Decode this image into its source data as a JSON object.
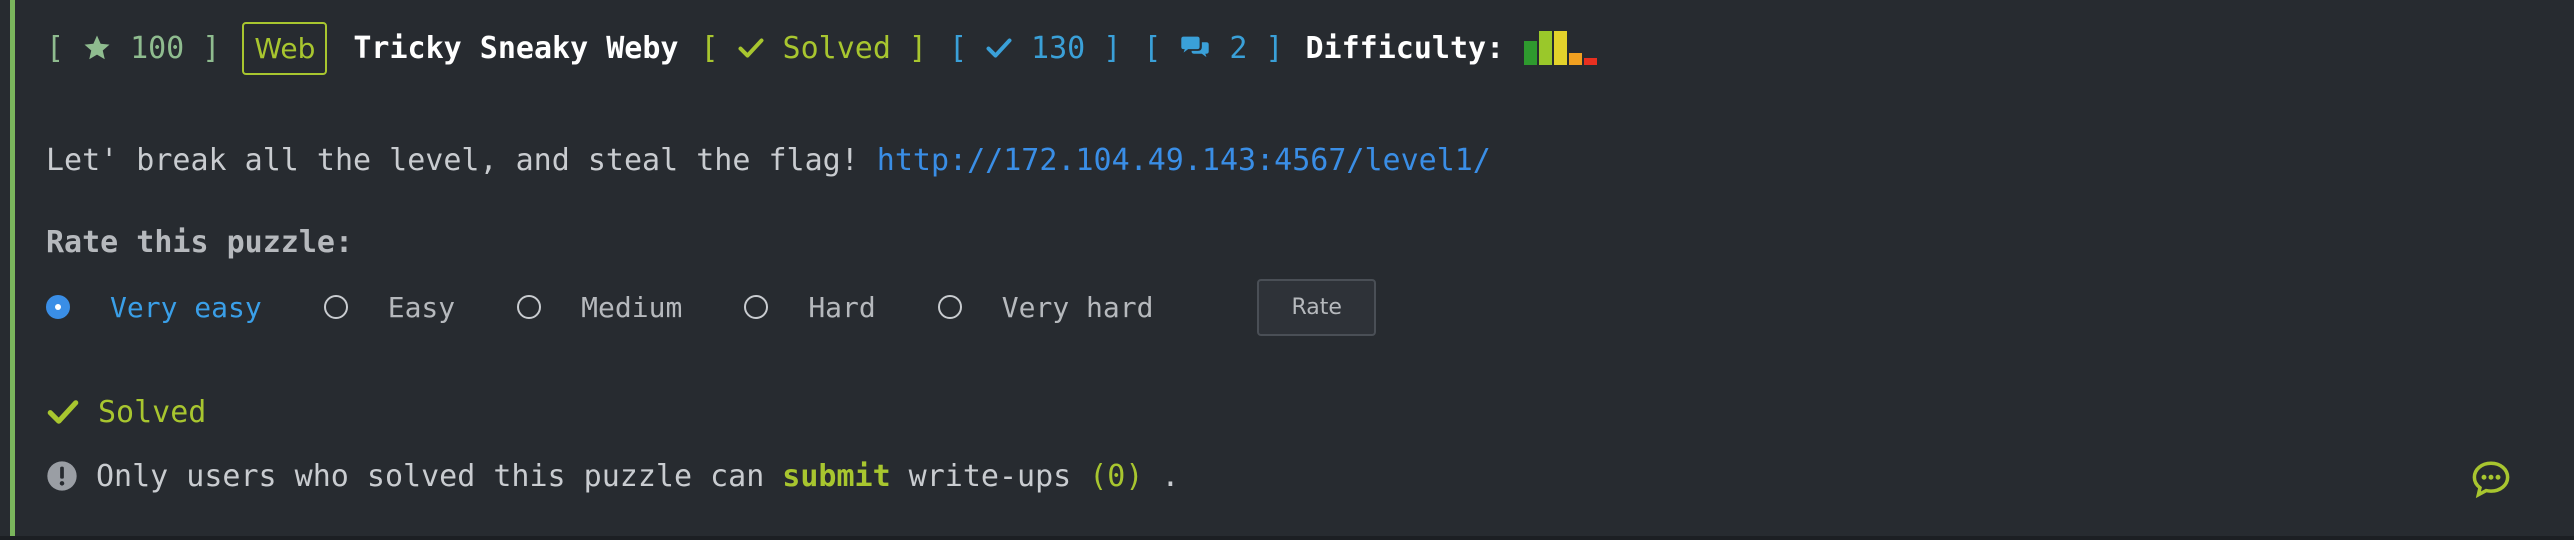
{
  "header": {
    "open_bracket": "[",
    "close_bracket": "]",
    "points": "100",
    "category": "Web",
    "title": "Tricky Sneaky Weby",
    "solved_label": "Solved",
    "solves_count": "130",
    "comments_count": "2",
    "difficulty_label": "Difficulty:",
    "difficulty_levels": [
      {
        "color": "#2e9a2e",
        "level": 0.7
      },
      {
        "color": "#9ac82a",
        "level": 1.0
      },
      {
        "color": "#e3d22b",
        "level": 1.0
      },
      {
        "color": "#f0a020",
        "level": 0.35
      },
      {
        "color": "#e83020",
        "level": 0.2
      }
    ]
  },
  "description": {
    "text": "Let' break all the level, and steal the flag!",
    "link": "http://172.104.49.143:4567/level1/"
  },
  "rating": {
    "label": "Rate this puzzle:",
    "options": [
      {
        "label": "Very easy",
        "selected": true
      },
      {
        "label": "Easy",
        "selected": false
      },
      {
        "label": "Medium",
        "selected": false
      },
      {
        "label": "Hard",
        "selected": false
      },
      {
        "label": "Very hard",
        "selected": false
      }
    ],
    "button_label": "Rate"
  },
  "status": {
    "solved_label": "Solved"
  },
  "writeups": {
    "text_before": "Only users who solved this puzzle can",
    "submit_link": "submit",
    "text_after": "write-ups",
    "count": "(0)",
    "period": "."
  },
  "colors": {
    "accent_green": "#a8c62f",
    "accent_blue": "#3a8ee6",
    "cyan": "#3aa0d8",
    "background": "#272b30"
  },
  "icons": {
    "points": "star-icon",
    "solved": "check-icon",
    "comments": "comments-icon",
    "info": "exclamation-circle-icon",
    "chat": "chat-bubble-icon"
  }
}
